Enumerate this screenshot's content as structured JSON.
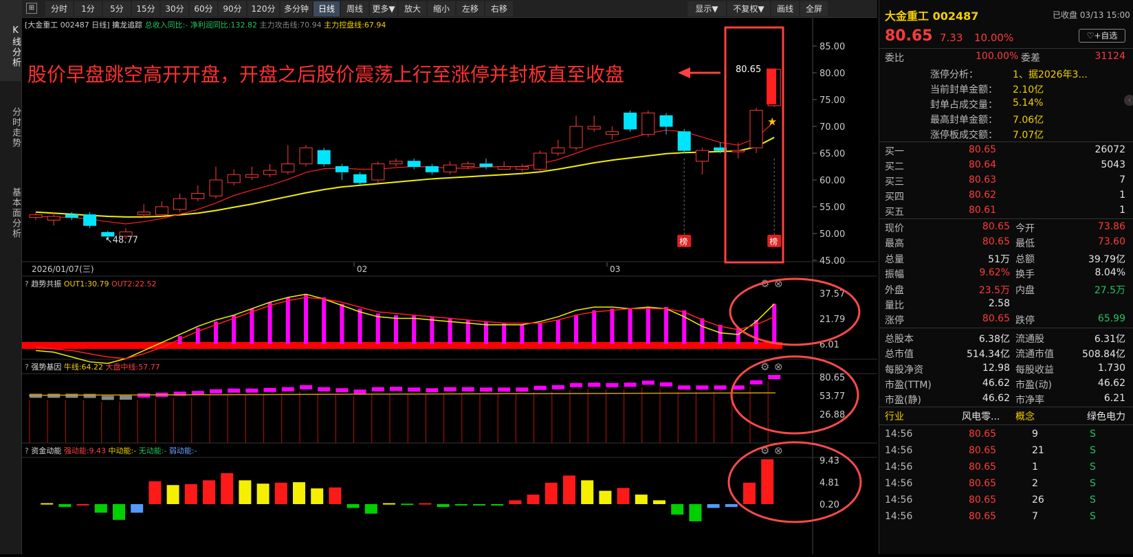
{
  "left_tabs": [
    {
      "label": "K线分析",
      "active": true
    },
    {
      "label": "分时走势",
      "active": false
    },
    {
      "label": "基本面分析",
      "active": false
    }
  ],
  "toolbar": {
    "items": [
      "分时",
      "1分",
      "5分",
      "15分",
      "30分",
      "60分",
      "90分",
      "120分",
      "多分钟",
      "日线",
      "周线",
      "更多▼",
      "放大",
      "缩小",
      "左移",
      "右移"
    ],
    "active": "日线",
    "right_items": [
      "显示▼",
      "不复权▼",
      "画线",
      "全屏"
    ]
  },
  "header": {
    "stock": "[大金重工 002487 日线]",
    "indicator": "擒龙追踪",
    "items": [
      {
        "text": "总收入同比:-",
        "color": "#22c55e"
      },
      {
        "text": "净利润同比:132.82",
        "color": "#22c55e"
      },
      {
        "text": "主力攻击线:70.94",
        "color": "#888888"
      },
      {
        "text": "主力控盘线:67.94",
        "color": "#f5d000"
      }
    ]
  },
  "annotation": "股价早盘跳空高开开盘，开盘之后股价震荡上行至涨停并封板直至收盘",
  "main_labels": {
    "last_price": "80.65",
    "low_mark": "48.77",
    "date_start": "2026/01/07(三)",
    "month2": "02",
    "month3": "03",
    "bang": "榜"
  },
  "price_axis": [
    "85.00",
    "80.00",
    "75.00",
    "70.00",
    "65.00",
    "60.00",
    "55.00",
    "50.00",
    "45.00"
  ],
  "panel1": {
    "title": "趋势共振",
    "out1": "OUT1:30.79",
    "out2": "OUT2:22.52",
    "axis": [
      "37.57",
      "21.79",
      "6.01"
    ]
  },
  "panel2": {
    "title": "强势基因",
    "l1": "牛线:64.22",
    "l2": "大盘中线:57.77",
    "axis": [
      "80.65",
      "53.77",
      "26.88"
    ]
  },
  "panel3": {
    "title": "资金动能",
    "l1": "强动能:9.43",
    "l2": "中动能:-",
    "l3": "无动能:-",
    "l4": "弱动能:-",
    "axis": [
      "9.43",
      "4.81",
      "0.20"
    ]
  },
  "chart_data": {
    "type": "candlestick",
    "x_range": [
      "2026-01-07",
      "2026-03-13"
    ],
    "ylim": [
      45,
      85
    ],
    "candles": [
      {
        "o": 53.0,
        "c": 53.5,
        "h": 54.0,
        "l": 52.5
      },
      {
        "o": 52.5,
        "c": 53.2,
        "h": 54.0,
        "l": 51.5
      },
      {
        "o": 53.5,
        "c": 53.0,
        "h": 54.0,
        "l": 52.5
      },
      {
        "o": 53.5,
        "c": 51.5,
        "h": 54.0,
        "l": 51.0
      },
      {
        "o": 50.2,
        "c": 49.5,
        "h": 50.5,
        "l": 48.8
      },
      {
        "o": 49.5,
        "c": 50.3,
        "h": 51.0,
        "l": 49.0
      },
      {
        "o": 53.5,
        "c": 54.0,
        "h": 55.5,
        "l": 53.0
      },
      {
        "o": 53.5,
        "c": 55.0,
        "h": 56.0,
        "l": 53.0
      },
      {
        "o": 54.5,
        "c": 56.5,
        "h": 57.5,
        "l": 54.0
      },
      {
        "o": 56.5,
        "c": 57.5,
        "h": 59.0,
        "l": 56.0
      },
      {
        "o": 57.0,
        "c": 60.0,
        "h": 62.5,
        "l": 56.5
      },
      {
        "o": 59.5,
        "c": 61.0,
        "h": 62.0,
        "l": 59.0
      },
      {
        "o": 60.5,
        "c": 61.0,
        "h": 62.5,
        "l": 60.0
      },
      {
        "o": 61.0,
        "c": 61.8,
        "h": 63.0,
        "l": 60.5
      },
      {
        "o": 61.5,
        "c": 63.0,
        "h": 66.5,
        "l": 61.0
      },
      {
        "o": 63.0,
        "c": 66.0,
        "h": 66.5,
        "l": 62.5
      },
      {
        "o": 65.5,
        "c": 63.0,
        "h": 66.0,
        "l": 62.5
      },
      {
        "o": 62.5,
        "c": 61.5,
        "h": 63.0,
        "l": 60.0
      },
      {
        "o": 61.0,
        "c": 59.5,
        "h": 61.5,
        "l": 59.0
      },
      {
        "o": 60.0,
        "c": 63.0,
        "h": 63.5,
        "l": 59.5
      },
      {
        "o": 63.0,
        "c": 63.5,
        "h": 64.0,
        "l": 62.5
      },
      {
        "o": 63.5,
        "c": 62.5,
        "h": 64.0,
        "l": 62.0
      },
      {
        "o": 62.5,
        "c": 61.5,
        "h": 63.0,
        "l": 61.0
      },
      {
        "o": 61.5,
        "c": 62.8,
        "h": 63.5,
        "l": 61.0
      },
      {
        "o": 62.5,
        "c": 63.0,
        "h": 63.5,
        "l": 62.0
      },
      {
        "o": 63.0,
        "c": 62.5,
        "h": 64.0,
        "l": 62.0
      },
      {
        "o": 62.0,
        "c": 62.5,
        "h": 63.5,
        "l": 62.0
      },
      {
        "o": 62.0,
        "c": 62.5,
        "h": 63.0,
        "l": 61.5
      },
      {
        "o": 62.0,
        "c": 65.0,
        "h": 65.5,
        "l": 61.5
      },
      {
        "o": 65.0,
        "c": 66.0,
        "h": 67.5,
        "l": 64.5
      },
      {
        "o": 66.0,
        "c": 70.0,
        "h": 72.0,
        "l": 65.5
      },
      {
        "o": 69.5,
        "c": 70.0,
        "h": 72.0,
        "l": 69.0
      },
      {
        "o": 68.5,
        "c": 69.0,
        "h": 70.0,
        "l": 67.5
      },
      {
        "o": 72.5,
        "c": 69.5,
        "h": 73.0,
        "l": 69.0
      },
      {
        "o": 68.5,
        "c": 72.5,
        "h": 73.0,
        "l": 68.0
      },
      {
        "o": 72.0,
        "c": 70.0,
        "h": 72.5,
        "l": 68.5
      },
      {
        "o": 69.0,
        "c": 65.5,
        "h": 69.5,
        "l": 65.0
      },
      {
        "o": 63.5,
        "c": 65.5,
        "h": 66.0,
        "l": 61.0
      },
      {
        "o": 66.0,
        "c": 65.5,
        "h": 67.0,
        "l": 65.0
      },
      {
        "o": 65.5,
        "c": 65.5,
        "h": 67.0,
        "l": 64.0
      },
      {
        "o": 66.0,
        "c": 73.0,
        "h": 73.5,
        "l": 65.0
      },
      {
        "o": 73.86,
        "c": 80.65,
        "h": 80.65,
        "l": 73.6
      }
    ],
    "ma_red": [
      53.2,
      53.1,
      53.0,
      52.7,
      52.2,
      51.8,
      52.2,
      52.8,
      53.6,
      54.5,
      55.7,
      57.1,
      58.1,
      59.0,
      60.1,
      61.4,
      62.1,
      62.2,
      62.0,
      62.0,
      62.3,
      62.5,
      62.4,
      62.2,
      62.2,
      62.4,
      62.5,
      62.5,
      63.0,
      63.8,
      65.0,
      66.2,
      67.0,
      67.8,
      68.7,
      69.3,
      69.0,
      68.0,
      67.0,
      66.5,
      67.8,
      70.94
    ],
    "ma_yellow": [
      54.0,
      53.8,
      53.6,
      53.4,
      53.2,
      53.1,
      53.1,
      53.2,
      53.5,
      53.8,
      54.3,
      54.9,
      55.5,
      56.2,
      56.9,
      57.6,
      58.2,
      58.7,
      59.0,
      59.3,
      59.6,
      59.9,
      60.2,
      60.4,
      60.6,
      60.8,
      61.0,
      61.2,
      61.5,
      62.0,
      62.6,
      63.2,
      63.7,
      64.1,
      64.5,
      64.9,
      65.1,
      65.2,
      65.3,
      65.4,
      66.2,
      67.94
    ],
    "panel1_bars": [
      3,
      2,
      1,
      0,
      -2,
      -3,
      2,
      6,
      11,
      16,
      20,
      24,
      28,
      32,
      35,
      37,
      35,
      31,
      28,
      25,
      24,
      24,
      23,
      22,
      21,
      20,
      19,
      18,
      19,
      21,
      24,
      27,
      28,
      28,
      29,
      29,
      27,
      22,
      18,
      16,
      21,
      31
    ],
    "panel1_yellow": [
      2,
      1,
      -2,
      -5,
      -6,
      -3,
      2,
      7,
      12,
      17,
      21,
      24,
      28,
      32,
      35,
      37,
      34,
      30,
      26,
      23,
      22,
      22,
      21,
      20,
      19,
      18,
      18,
      18,
      20,
      23,
      27,
      29,
      29,
      28,
      29,
      28,
      23,
      17,
      13,
      12,
      20,
      31
    ],
    "panel1_red": [
      4,
      3,
      2,
      0,
      -2,
      -3,
      0,
      4,
      9,
      14,
      18,
      22,
      26,
      30,
      33,
      35,
      34,
      32,
      29,
      26,
      25,
      24,
      23,
      22,
      21,
      20,
      19,
      19,
      19,
      21,
      24,
      26,
      27,
      28,
      28,
      28,
      26,
      21,
      17,
      15,
      18,
      23
    ],
    "panel2_boxes": [
      53.5,
      53.5,
      53.5,
      53.3,
      50.5,
      50.8,
      54,
      55,
      56.5,
      57.5,
      60,
      61,
      61,
      62,
      63,
      66,
      63,
      61.5,
      59.5,
      63,
      63.5,
      62.5,
      61.5,
      63,
      63,
      62.5,
      62.5,
      62.5,
      65,
      66,
      69,
      69.5,
      69,
      69.5,
      72.5,
      70,
      65.5,
      65.5,
      65.5,
      65.5,
      73,
      80.65
    ],
    "panel3_bars": [
      0.2,
      -0.6,
      0.0,
      -1.8,
      -3.3,
      -1.8,
      4.8,
      4.0,
      4.2,
      5.0,
      6.5,
      5.0,
      4.3,
      4.5,
      4.6,
      3.3,
      3.5,
      -0.8,
      -2.0,
      0.2,
      0.1,
      0.2,
      -0.6,
      -0.2,
      -0.1,
      -0.3,
      0.8,
      2.0,
      4.5,
      6.0,
      5.0,
      2.8,
      3.4,
      2.0,
      0.8,
      -2.2,
      -3.6,
      -0.8,
      -0.6,
      4.5,
      9.43
    ],
    "panel3_colors": [
      "yellow",
      "green",
      "red",
      "green",
      "green",
      "blue",
      "red",
      "yellow",
      "red",
      "red",
      "red",
      "yellow",
      "yellow",
      "red",
      "yellow",
      "yellow",
      "red",
      "green",
      "green",
      "yellow",
      "green",
      "red",
      "green",
      "green",
      "green",
      "green",
      "red",
      "red",
      "red",
      "red",
      "yellow",
      "yellow",
      "red",
      "yellow",
      "yellow",
      "green",
      "green",
      "blue",
      "blue",
      "red",
      "red"
    ]
  },
  "right_panel": {
    "title": "大金重工 002487",
    "status": "已收盘 03/13 15:00",
    "price": "80.65",
    "change": "7.33",
    "pct": "10.00%",
    "add_btn": "+自选",
    "weibi_label": "委比",
    "weibi": "100.00%",
    "weicha_label": "委差",
    "weicha": "31124",
    "info": [
      {
        "k": "涨停分析：",
        "v": "1、据2026年3..."
      },
      {
        "k": "当前封单金额：",
        "v": "2.10亿"
      },
      {
        "k": "封单占成交量：",
        "v": "5.14%"
      },
      {
        "k": "最高封单金额：",
        "v": "7.06亿"
      },
      {
        "k": "涨停板成交额：",
        "v": "7.07亿"
      }
    ],
    "buys": [
      {
        "k": "买一",
        "p": "80.65",
        "v": "26072"
      },
      {
        "k": "买二",
        "p": "80.64",
        "v": "5043"
      },
      {
        "k": "买三",
        "p": "80.63",
        "v": "7"
      },
      {
        "k": "买四",
        "p": "80.62",
        "v": "1"
      },
      {
        "k": "买五",
        "p": "80.61",
        "v": "1"
      }
    ],
    "quote": [
      {
        "k1": "现价",
        "v1": "80.65",
        "c1": "red",
        "k2": "今开",
        "v2": "73.86",
        "c2": "red"
      },
      {
        "k1": "最高",
        "v1": "80.65",
        "c1": "red",
        "k2": "最低",
        "v2": "73.60",
        "c2": "red"
      },
      {
        "k1": "总量",
        "v1": "51万",
        "c1": "white",
        "k2": "总额",
        "v2": "39.79亿",
        "c2": "white"
      },
      {
        "k1": "振幅",
        "v1": "9.62%",
        "c1": "red",
        "k2": "换手",
        "v2": "8.04%",
        "c2": "white"
      },
      {
        "k1": "外盘",
        "v1": "23.5万",
        "c1": "red",
        "k2": "内盘",
        "v2": "27.5万",
        "c2": "green"
      },
      {
        "k1": "量比",
        "v1": "2.58",
        "c1": "white",
        "k2": "",
        "v2": "",
        "c2": "white"
      },
      {
        "k1": "涨停",
        "v1": "80.65",
        "c1": "red",
        "k2": "跌停",
        "v2": "65.99",
        "c2": "green"
      },
      {
        "k1": "总股本",
        "v1": "6.38亿",
        "c1": "white",
        "k2": "流通股",
        "v2": "6.31亿",
        "c2": "white"
      },
      {
        "k1": "总市值",
        "v1": "514.34亿",
        "c1": "white",
        "k2": "流通市值",
        "v2": "508.84亿",
        "c2": "white"
      },
      {
        "k1": "每股净资",
        "v1": "12.98",
        "c1": "white",
        "k2": "每股收益",
        "v2": "1.730",
        "c2": "white"
      },
      {
        "k1": "市盈(TTM)",
        "v1": "46.62",
        "c1": "white",
        "k2": "市盈(动)",
        "v2": "46.62",
        "c2": "white"
      },
      {
        "k1": "市盈(静)",
        "v1": "46.62",
        "c1": "white",
        "k2": "市净率",
        "v2": "6.21",
        "c2": "white"
      }
    ],
    "industry": {
      "k1": "行业",
      "v1": "风电零...",
      "k2": "概念",
      "v2": "绿色电力"
    },
    "trades": [
      {
        "t": "14:56",
        "p": "80.65",
        "v": "9",
        "s": "S"
      },
      {
        "t": "14:56",
        "p": "80.65",
        "v": "21",
        "s": "S"
      },
      {
        "t": "14:56",
        "p": "80.65",
        "v": "1",
        "s": "S"
      },
      {
        "t": "14:56",
        "p": "80.65",
        "v": "2",
        "s": "S"
      },
      {
        "t": "14:56",
        "p": "80.65",
        "v": "26",
        "s": "S"
      },
      {
        "t": "14:56",
        "p": "80.65",
        "v": "7",
        "s": "S"
      }
    ]
  },
  "colors": {
    "up": "#ff3b3b",
    "down": "#00e5ff",
    "bg": "#000000",
    "ma_red": "#ff2020",
    "ma_yellow": "#f5f000",
    "magenta": "#ff00ff",
    "highlight": "#ff4040"
  }
}
